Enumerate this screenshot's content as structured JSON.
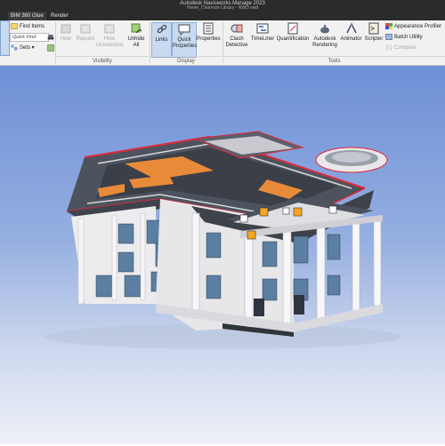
{
  "app": {
    "title": "Autodesk Navisworks Manage 2023",
    "file": "Heme_Charman Library - NWD.nwd"
  },
  "tabs": [
    {
      "label": "BIM 360 Glue"
    },
    {
      "label": "Render"
    }
  ],
  "ribbon": {
    "select": {
      "find_items": "Find Items",
      "quick_find_placeholder": "Quick Find",
      "sets": "Sets"
    },
    "visibility": {
      "label": "Visibility",
      "hide": "Hide",
      "require": "Require",
      "hide_unselected": "Hide Unselected",
      "unhide_all": "Unhide All"
    },
    "display": {
      "label": "Display",
      "links": "Links",
      "quick_properties": "Quick Properties",
      "properties": "Properties"
    },
    "tools": {
      "label": "Tools",
      "clash_detective": "Clash Detective",
      "timeliner": "TimeLiner",
      "quantification": "Quantification",
      "autodesk_rendering": "Autodesk Rendering",
      "animator": "Animator",
      "scripter": "Scripter",
      "appearance_profiler": "Appearance Profiler",
      "batch_utility": "Batch Utility",
      "compare": "Compare"
    }
  },
  "colors": {
    "chrome_dark": "#2b2b2b",
    "ribbon_bg": "#f1f1f1",
    "active_button": "#c8daf0",
    "sky_top": "#6e90d6",
    "roof_edge": "#e0283a",
    "facade": "#ececee",
    "roof_dark": "#4a4f58"
  }
}
